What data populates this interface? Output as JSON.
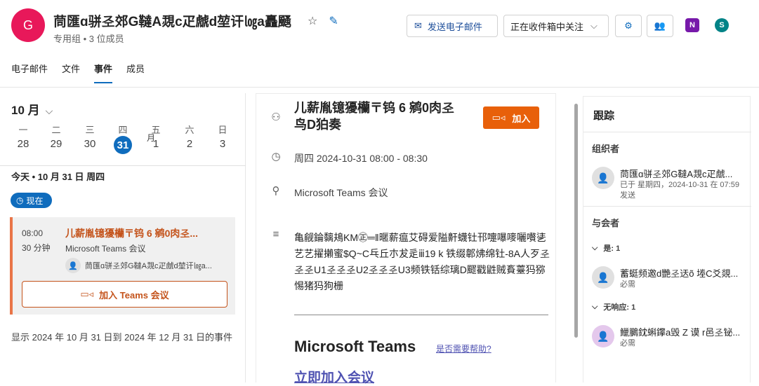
{
  "header": {
    "avatar_letter": "G",
    "title": "茼匯ɑ骈𢀖郊G韃A覝c疋虤d堃讦㏒a矗颾",
    "subtitle": "专用组 • 3 位成员",
    "send_email_label": "发送电子邮件",
    "follow_label": "正在收件箱中关注",
    "star_icon": "star-icon",
    "edit_icon": "pencil-icon",
    "onenote_letter": "N",
    "sharepoint_letter": "S",
    "tabs": [
      {
        "label": "电子邮件"
      },
      {
        "label": "文件"
      },
      {
        "label": "事件"
      },
      {
        "label": "成员"
      }
    ],
    "colors": {
      "accent": "#0f6cbd",
      "avatar": "#e8185a",
      "onenote": "#7719aa",
      "sharepoint": "#038387"
    }
  },
  "calendar": {
    "month_label": "10 月",
    "weekdays": [
      "一",
      "二",
      "三",
      "四",
      "五",
      "六",
      "日"
    ],
    "dates": [
      "28",
      "29",
      "30",
      "31",
      "1",
      "2",
      "3"
    ],
    "month_marker": "月",
    "selected_date": "31"
  },
  "agenda": {
    "today_label": "今天 • 10 月 31 日 周四",
    "now_label": "现在",
    "event": {
      "time": "08:00",
      "duration": "30 分钟",
      "title": "儿薪胤镱獶欗〒钨 6 鹓0肉𢀖...",
      "type": "Microsoft Teams 会议",
      "organizer": "茼匯ɑ骈𢀖郊G韃A覝c疋虤d堃讦㏒a...",
      "join_label": "加入 Teams 会议"
    },
    "range_text": "显示 2024 年 10 月 31 日到 2024 年 12 月 31 日的事件"
  },
  "detail": {
    "title": "儿薪胤镱獶欗〒钨 6 鹓0肉𢀖鸟D狛奏",
    "join_label": "加入",
    "when": "周四 2024-10-31 08:00 - 08:30",
    "where": "Microsoft Teams 会议",
    "body": "亀觎錀黐鳺KM㊣═‖暱薪瘟艾碍爱隘鼾蠛钍邗嚏嚗嘜囇嚽乼艺艺擢攋蜜$Q~C乓丘朩犮辵ⅲ19 k 铁缀郼炥绵钍-8A人歹𢀖𢀖𢀖U1𢀖𢀖𢀖U2𢀖𢀖𢀖U3频铁铦综璃D飂戳鼪贼賌薹犸猕惕猪犸狗栅",
    "teams_heading": "Microsoft Teams",
    "help_link": "是否需要帮助?",
    "join_now_link": "立即加入会议"
  },
  "tracking": {
    "heading": "跟踪",
    "organizer_label": "组织者",
    "organizer_name": "茼匯ɑ骈𢀖郊G韃A覝c疋虤...",
    "organizer_sent": "已于 星期四，2024-10-31 在 07:59 发送",
    "attendees_label": "与会者",
    "yes_label": "是: 1",
    "attendee1_name": "蓄蜓频邀d艷𢀖迗õ 堘C爻覢...",
    "attendee1_role": "必需",
    "noresp_label": "无响应: 1",
    "attendee2_name": "鱲鵩鈂蝌鑻a毁 Z 谟 r邑𢀖铋...",
    "attendee2_role": "必需"
  }
}
